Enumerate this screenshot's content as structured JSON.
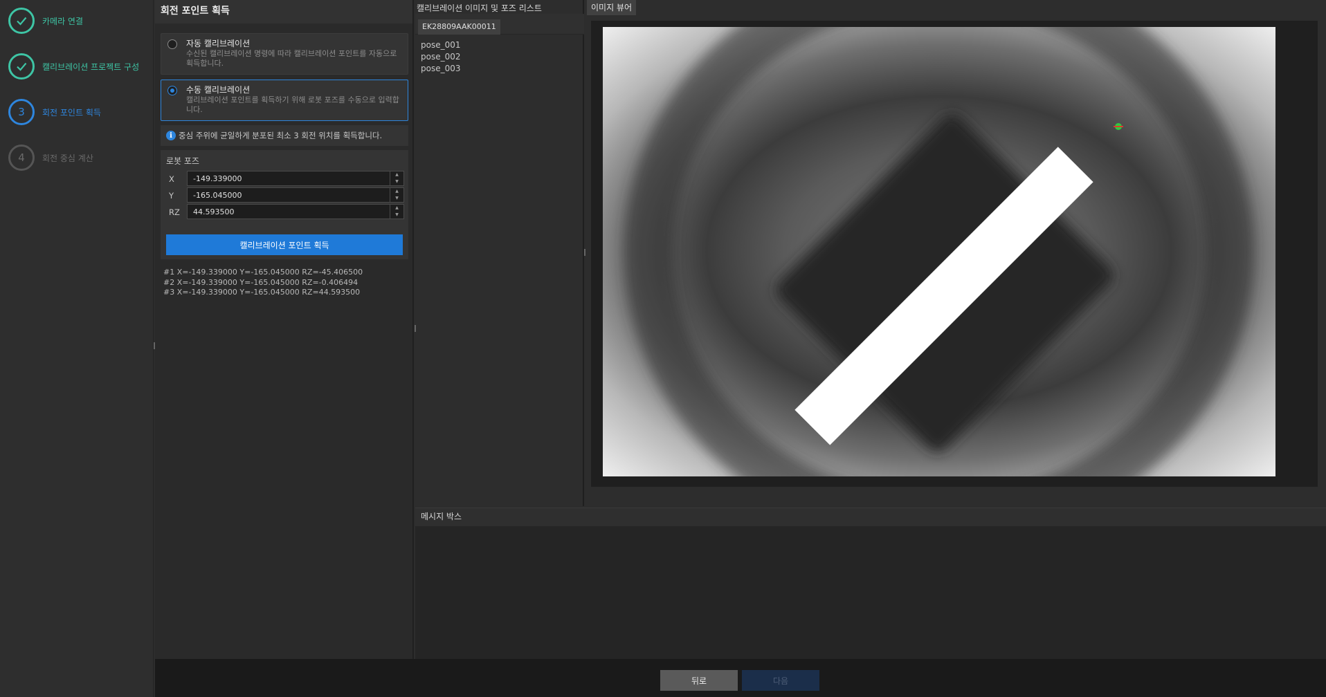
{
  "stepper": {
    "steps": [
      {
        "number": "1",
        "label": "카메라 연결",
        "state": "done"
      },
      {
        "number": "2",
        "label": "캘리브레이션 프로젝트 구성",
        "state": "done"
      },
      {
        "number": "3",
        "label": "회전 포인트 획득",
        "state": "active"
      },
      {
        "number": "4",
        "label": "회전 중심 계산",
        "state": "pending"
      }
    ]
  },
  "panel": {
    "title": "회전 포인트 획득",
    "auto_option": {
      "title": "자동 캘리브레이션",
      "description": "수신된 캘리브레이션 명령에 따라 캘리브레이션 포인트를 자동으로 획득합니다."
    },
    "manual_option": {
      "title": "수동 캘리브레이션",
      "description": "캘리브레이션 포인트를 획득하기 위해 로봇 포즈를 수동으로 입력합니다."
    },
    "info_text": "중심 주위에 균일하게 분포된 최소 3 회전 위치를 획득합니다.",
    "robot_pose": {
      "title": "로봇 포즈",
      "x_label": "X",
      "x_value": "-149.339000",
      "y_label": "Y",
      "y_value": "-165.045000",
      "rz_label": "RZ",
      "rz_value": "44.593500",
      "acquire_label": "캘리브레이션 포인트 획득"
    },
    "log": [
      "#1  X=-149.339000  Y=-165.045000  RZ=-45.406500",
      "#2  X=-149.339000  Y=-165.045000  RZ=-0.406494",
      "#3  X=-149.339000  Y=-165.045000  RZ=44.593500"
    ]
  },
  "image_list": {
    "title": "캘리브레이션 이미지 및 포즈 리스트",
    "camera_id": "EK28809AAK00011",
    "poses": [
      "pose_001",
      "pose_002",
      "pose_003"
    ]
  },
  "viewer": {
    "tab_label": "이미지 뷰어"
  },
  "message_box": {
    "title": "메시지 박스"
  },
  "footer": {
    "back_label": "뒤로",
    "next_label": "다음"
  },
  "colors": {
    "done": "#3ec5a5",
    "active": "#2e86de",
    "primary_button": "#1f7ad8"
  }
}
